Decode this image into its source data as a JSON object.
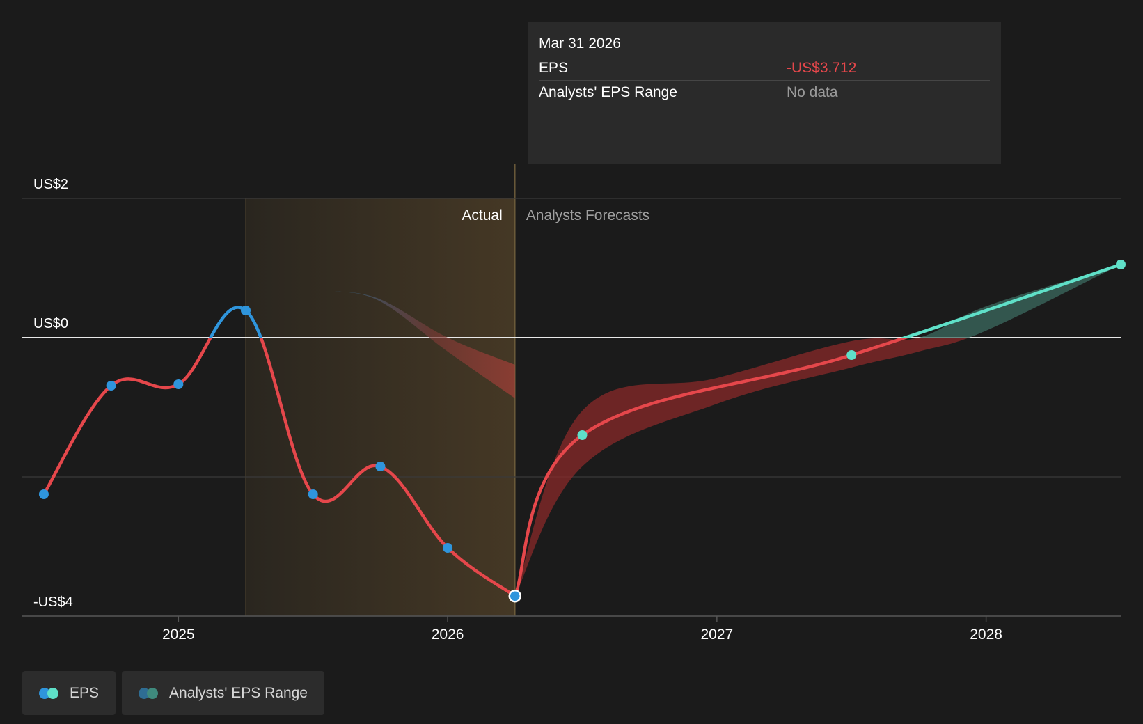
{
  "chart_data": {
    "type": "line",
    "x_axis": {
      "range": [
        2024.42,
        2028.5
      ],
      "ticks": [
        {
          "value": 2025,
          "label": "2025"
        },
        {
          "value": 2026,
          "label": "2026"
        },
        {
          "value": 2027,
          "label": "2027"
        },
        {
          "value": 2028,
          "label": "2028"
        }
      ]
    },
    "y_axis": {
      "range": [
        -4,
        2
      ],
      "ticks": [
        {
          "value": 2,
          "label": "US$2"
        },
        {
          "value": 0,
          "label": "US$0"
        },
        {
          "value": -2,
          "label": ""
        },
        {
          "value": -4,
          "label": "-US$4"
        }
      ],
      "grid": true
    },
    "regions": {
      "actual_label": "Actual",
      "forecast_label": "Analysts Forecasts",
      "highlight_start": 2025.25,
      "divider": 2026.25
    },
    "series": [
      {
        "name": "EPS",
        "kind": "actual",
        "points": [
          {
            "x": 2024.5,
            "y": -2.25
          },
          {
            "x": 2024.75,
            "y": -0.69
          },
          {
            "x": 2025.0,
            "y": -0.67
          },
          {
            "x": 2025.25,
            "y": 0.39
          },
          {
            "x": 2025.5,
            "y": -2.25
          },
          {
            "x": 2025.75,
            "y": -1.85
          },
          {
            "x": 2026.0,
            "y": -3.02
          },
          {
            "x": 2026.25,
            "y": -3.712
          }
        ]
      },
      {
        "name": "EPS",
        "kind": "forecast",
        "points": [
          {
            "x": 2026.25,
            "y": -3.712
          },
          {
            "x": 2026.5,
            "y": -1.4
          },
          {
            "x": 2027.5,
            "y": -0.25
          },
          {
            "x": 2028.5,
            "y": 1.05
          }
        ]
      }
    ],
    "range_band": {
      "name": "Analysts' EPS Range",
      "past_band": {
        "upper": [
          [
            2025.58,
            0.67
          ],
          [
            2025.75,
            0.55
          ],
          [
            2026.0,
            0.0
          ],
          [
            2026.25,
            -0.39
          ]
        ],
        "lower": [
          [
            2025.58,
            0.67
          ],
          [
            2025.75,
            0.52
          ],
          [
            2026.0,
            -0.2
          ],
          [
            2026.25,
            -0.87
          ]
        ]
      },
      "forecast_band": {
        "upper": [
          [
            2026.25,
            -3.712
          ],
          [
            2026.5,
            -1.05
          ],
          [
            2027.0,
            -0.58
          ],
          [
            2027.5,
            -0.05
          ],
          [
            2027.75,
            0.0
          ],
          [
            2028.0,
            0.45
          ],
          [
            2028.5,
            1.05
          ]
        ],
        "lower": [
          [
            2026.25,
            -3.712
          ],
          [
            2026.5,
            -1.85
          ],
          [
            2027.0,
            -0.95
          ],
          [
            2027.5,
            -0.43
          ],
          [
            2027.75,
            -0.2
          ],
          [
            2028.0,
            0.1
          ],
          [
            2028.5,
            1.05
          ]
        ]
      }
    },
    "colors": {
      "negative_line": "#e5474b",
      "positive_actual": "#2f95dc",
      "positive_forecast": "#5fe0c8",
      "actual_marker": "#2f95dc",
      "forecast_marker": "#5fe0c8",
      "band_past": "#3a6f94",
      "band_negative": "#8a2a2a",
      "band_positive": "#3c6b60",
      "highlight": "#4a3b22"
    }
  },
  "tooltip": {
    "date": "Mar 31 2026",
    "rows": [
      {
        "label": "EPS",
        "value": "-US$3.712"
      },
      {
        "label": "Analysts' EPS Range",
        "value": "No data"
      }
    ]
  },
  "legend": [
    {
      "label": "EPS",
      "colors": [
        "#2f95dc",
        "#5fe0c8"
      ]
    },
    {
      "label": "Analysts' EPS Range",
      "colors": [
        "#2f6d93",
        "#3f8a7d"
      ]
    }
  ]
}
